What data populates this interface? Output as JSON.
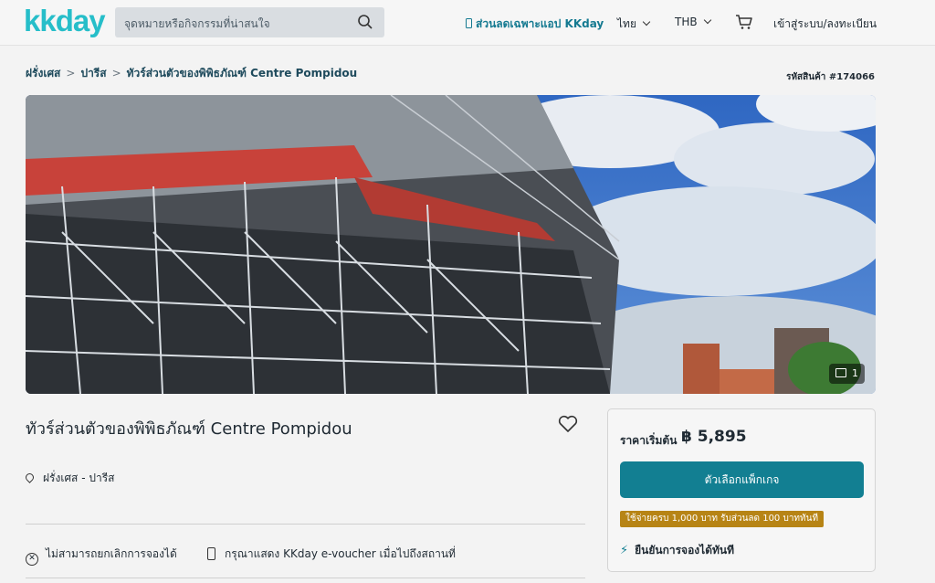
{
  "header": {
    "logo": "kkday",
    "search_placeholder": "จุดหมายหรือกิจกรรมที่น่าสนใจ",
    "app_promo": "ส่วนลดเฉพาะแอป KKday",
    "language": "ไทย",
    "currency": "THB",
    "login": "เข้าสู่ระบบ/ลงทะเบียน"
  },
  "breadcrumb": {
    "items": [
      "ฝรั่งเศส",
      "ปารีส",
      "ทัวร์ส่วนตัวของพิพิธภัณฑ์ Centre Pompidou"
    ],
    "separator": ">"
  },
  "sku": "รหัสสินค้า #174066",
  "gallery": {
    "photo_count": "1"
  },
  "product": {
    "title": "ทัวร์ส่วนตัวของพิพิธภัณฑ์ Centre Pompidou",
    "location": "ฝรั่งเศส - ปารีส",
    "features": [
      "ไม่สามารถยกเลิกการจองได้",
      "กรุณาแสดง KKday e-voucher เมื่อไปถึงสถานที่"
    ]
  },
  "pricing": {
    "label": "ราคาเริ่มต้น",
    "value": "฿ 5,895",
    "cta": "ตัวเลือกแพ็กเกจ",
    "promo": "ใช้จ่ายครบ 1,000 บาท รับส่วนลด 100 บาททันที",
    "instant": "ยืนยันการจองได้ทันที"
  },
  "colors": {
    "brand": "#26bec9",
    "cta": "#127f92",
    "promo_badge": "#b78415"
  },
  "icons": [
    "search-icon",
    "phone-icon",
    "chevron-down-icon",
    "cart-icon",
    "photo-icon",
    "heart-icon",
    "pin-icon",
    "cancel-icon",
    "mobile-icon",
    "bolt-icon"
  ]
}
